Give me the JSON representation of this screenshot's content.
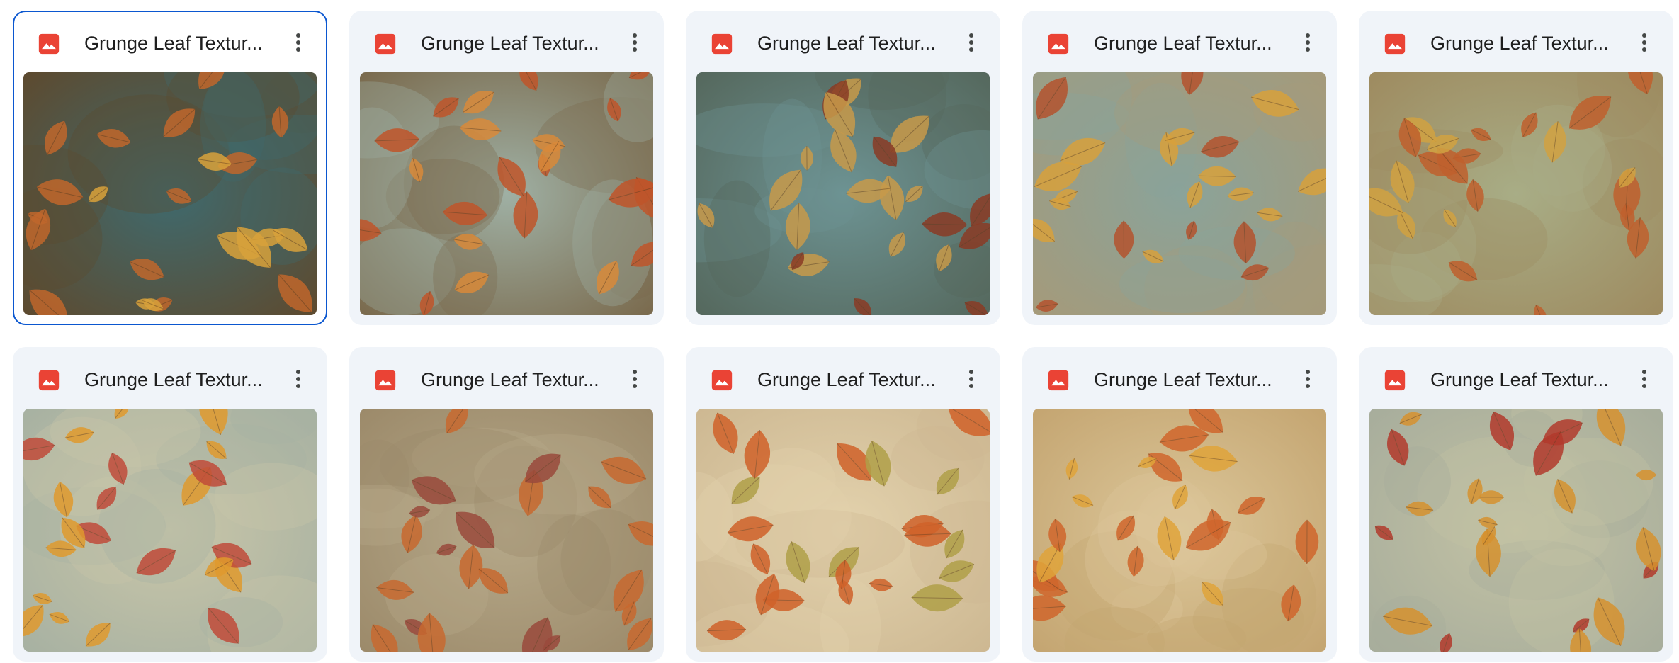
{
  "file_grid": {
    "selected_index": 0,
    "icon": "image-file-icon",
    "icon_color": "#ea4335",
    "more_icon": "more-vert-icon",
    "items": [
      {
        "title": "Grunge Leaf Textur...",
        "palette": {
          "base": "#5d4a2f",
          "wash": "#3f6a6e",
          "leaf": "#c0672c",
          "leaf2": "#d9a23b"
        }
      },
      {
        "title": "Grunge Leaf Textur...",
        "palette": {
          "base": "#7a6a4d",
          "wash": "#9fb0a4",
          "leaf": "#c0552a",
          "leaf2": "#d98a3a"
        }
      },
      {
        "title": "Grunge Leaf Textur...",
        "palette": {
          "base": "#55685d",
          "wash": "#6d9393",
          "leaf": "#c89a4a",
          "leaf2": "#8a3b25"
        }
      },
      {
        "title": "Grunge Leaf Textur...",
        "palette": {
          "base": "#a59a7a",
          "wash": "#8aa39a",
          "leaf": "#d8a13c",
          "leaf2": "#b4532e"
        }
      },
      {
        "title": "Grunge Leaf Textur...",
        "palette": {
          "base": "#9e8b60",
          "wash": "#a8ad86",
          "leaf": "#c0602d",
          "leaf2": "#d2a241"
        }
      },
      {
        "title": "Grunge Leaf Textur...",
        "palette": {
          "base": "#a7b1a2",
          "wash": "#c9c6a8",
          "leaf": "#e09a2e",
          "leaf2": "#c04b3a"
        }
      },
      {
        "title": "Grunge Leaf Textur...",
        "palette": {
          "base": "#9c8a6a",
          "wash": "#b6a98a",
          "leaf": "#c8692f",
          "leaf2": "#9a4a3c"
        }
      },
      {
        "title": "Grunge Leaf Textur...",
        "palette": {
          "base": "#cdb892",
          "wash": "#e3d2ad",
          "leaf": "#d0622a",
          "leaf2": "#b0a048"
        }
      },
      {
        "title": "Grunge Leaf Textur...",
        "palette": {
          "base": "#c4a571",
          "wash": "#dcc79a",
          "leaf": "#d0662c",
          "leaf2": "#e0a43a"
        }
      },
      {
        "title": "Grunge Leaf Textur...",
        "palette": {
          "base": "#a7ad9c",
          "wash": "#c3c2a4",
          "leaf": "#d6922f",
          "leaf2": "#b23a2c"
        }
      }
    ]
  }
}
